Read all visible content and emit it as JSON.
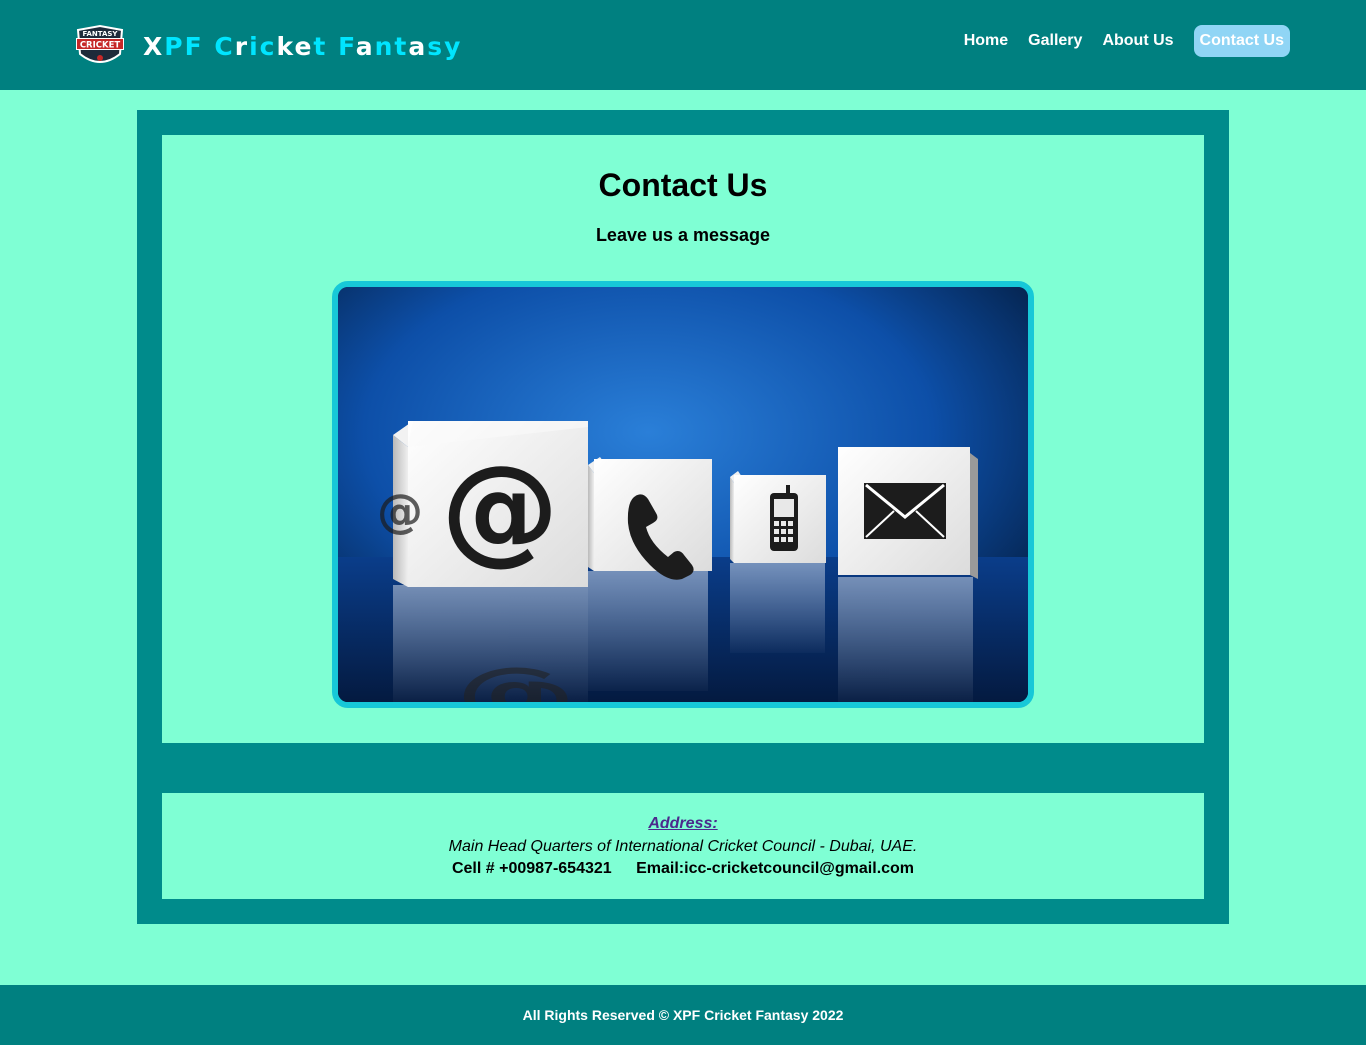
{
  "header": {
    "brand_parts": [
      {
        "text": "X",
        "color": "#ffffff"
      },
      {
        "text": "PF",
        "color": "#00e5ff"
      },
      {
        "text": " ",
        "color": "#ffffff"
      },
      {
        "text": "C",
        "color": "#00e5ff"
      },
      {
        "text": "r",
        "color": "#ffffff"
      },
      {
        "text": "ic",
        "color": "#00e5ff"
      },
      {
        "text": "ke",
        "color": "#ffffff"
      },
      {
        "text": "t",
        "color": "#00e5ff"
      },
      {
        "text": " ",
        "color": "#ffffff"
      },
      {
        "text": "F",
        "color": "#00e5ff"
      },
      {
        "text": "a",
        "color": "#ffffff"
      },
      {
        "text": "nt",
        "color": "#00e5ff"
      },
      {
        "text": "a",
        "color": "#ffffff"
      },
      {
        "text": "sy",
        "color": "#00e5ff"
      }
    ],
    "logo_text_top": "FANTASY",
    "logo_text_bottom": "CRICKET",
    "nav": [
      {
        "label": "Home",
        "active": false
      },
      {
        "label": "Gallery",
        "active": false
      },
      {
        "label": "About Us",
        "active": false
      },
      {
        "label": "Contact Us",
        "active": true
      }
    ]
  },
  "main": {
    "title": "Contact Us",
    "subtitle": "Leave us a message",
    "image_icons": [
      "at-sign-icon",
      "phone-icon",
      "mobile-phone-icon",
      "envelope-icon"
    ]
  },
  "info": {
    "address_label": "Address:",
    "address": "Main Head Quarters of International Cricket Council - Dubai, UAE.",
    "cell": "Cell # +00987-654321",
    "email": "Email:icc-cricketcouncil@gmail.com"
  },
  "footer": {
    "text": "All Rights Reserved © XPF Cricket Fantasy 2022"
  },
  "colors": {
    "header_bg": "#008080",
    "page_bg": "#7fffd4",
    "panel_bg": "#008b8b",
    "active_nav_bg": "#90d5f5",
    "image_border": "#17c8d8"
  }
}
